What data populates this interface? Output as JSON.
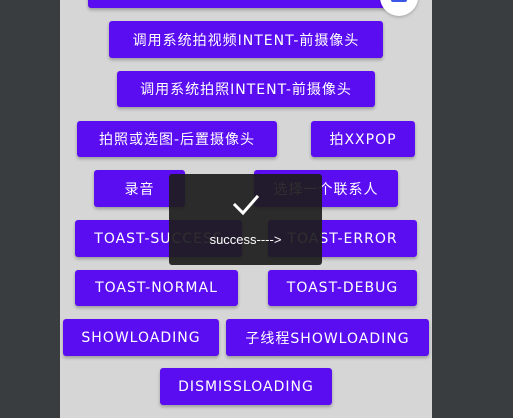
{
  "buttons": {
    "partial_top": "",
    "video_front": "调用系统拍视频INTENT-前摄像头",
    "photo_front": "调用系统拍照INTENT-前摄像头",
    "photo_or_pick_rear": "拍照或选图-后置摄像头",
    "xxpop": "拍XXPOP",
    "record": "录音",
    "pick_contact": "选择一个联系人",
    "toast_success": "TOAST-SUCCESS",
    "toast_error": "TOAST-ERROR",
    "toast_normal": "TOAST-NORMAL",
    "toast_debug": "TOAST-DEBUG",
    "show_loading": "SHOWLOADING",
    "thread_show_loading": "子线程SHOWLOADING",
    "dismiss_loading": "DISMISSLOADING"
  },
  "toast": {
    "icon": "check-icon",
    "message": "success---->"
  },
  "colors": {
    "button": "#5b0df2",
    "screen_bg": "#d6d6d6",
    "outer_bg": "#3a3d40",
    "toast_bg": "#1c1c1c"
  }
}
